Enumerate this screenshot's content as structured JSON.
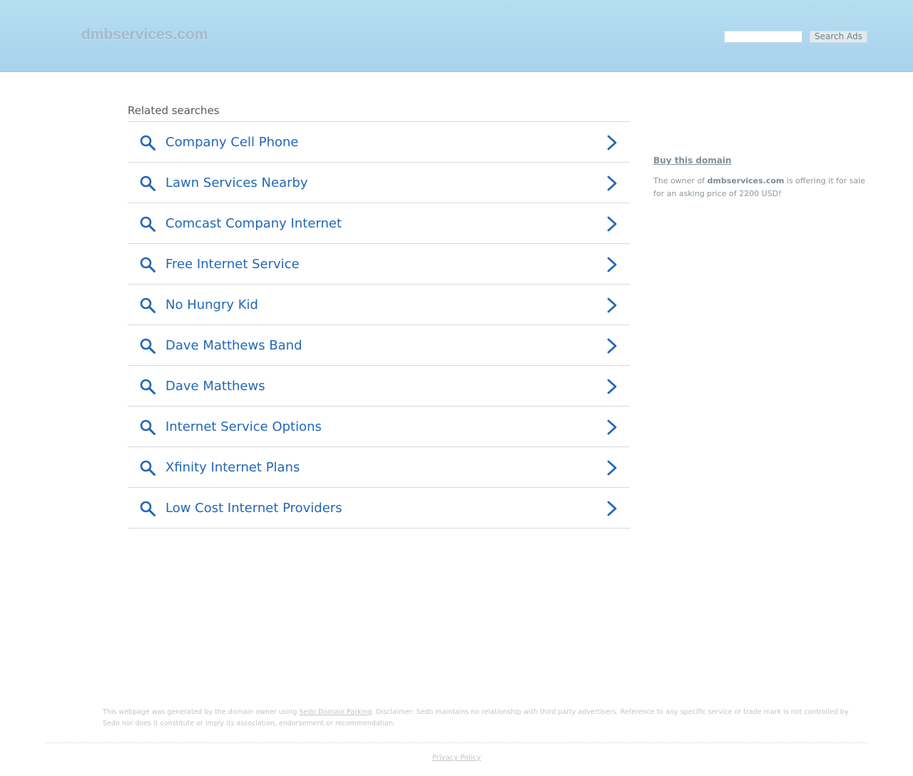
{
  "header": {
    "logo": "dmbservices.com",
    "search_placeholder": "",
    "search_button": "Search Ads"
  },
  "related": {
    "title": "Related searches",
    "items": [
      {
        "label": "Company Cell Phone"
      },
      {
        "label": "Lawn Services Nearby"
      },
      {
        "label": "Comcast Company Internet"
      },
      {
        "label": "Free Internet Service"
      },
      {
        "label": "No Hungry Kid"
      },
      {
        "label": "Dave Matthews Band"
      },
      {
        "label": "Dave Matthews"
      },
      {
        "label": "Internet Service Options"
      },
      {
        "label": "Xfinity Internet Plans"
      },
      {
        "label": "Low Cost Internet Providers"
      }
    ]
  },
  "sidebar": {
    "buy_link": "Buy this domain",
    "text_prefix": "The owner of ",
    "domain": "dmbservices.com",
    "text_suffix": " is offering it for sale for an asking price of 2200 USD!"
  },
  "footer": {
    "disclaimer_prefix": "This webpage was generated by the domain owner using ",
    "disclaimer_link": "Sedo Domain Parking",
    "disclaimer_suffix": ". Disclaimer: Sedo maintains no relationship with third party advertisers. Reference to any specific service or trade mark is not controlled by Sedo nor does it constitute or imply its association, endorsement or recommendation.",
    "privacy": "Privacy Policy"
  },
  "colors": {
    "header_bg": "#b5def1",
    "link_blue": "#2267b7",
    "muted_text": "#8a969e"
  }
}
